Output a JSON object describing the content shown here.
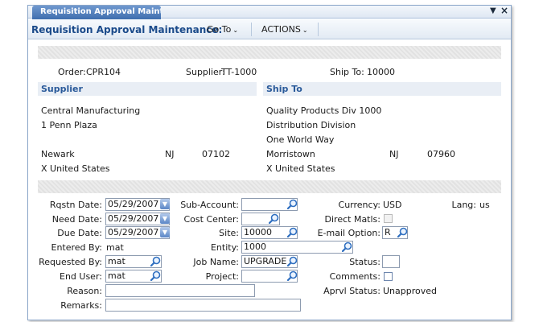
{
  "tab": {
    "label": "Requisition Approval Mainte..."
  },
  "window_controls": {
    "dropdown": "▼",
    "close": "×"
  },
  "menubar": {
    "title": "Requisition Approval Maintenance:",
    "goto_label": "Go To",
    "actions_label": "ACTIONS"
  },
  "header": {
    "order_label": "Order:",
    "order_value": "CPR104",
    "supplier_label": "Supplier:",
    "supplier_value": "TT-1000",
    "shipto_label": "Ship To:",
    "shipto_value": "10000"
  },
  "supplier": {
    "heading": "Supplier",
    "name": "Central Manufacturing",
    "address1": "1 Penn Plaza",
    "city": "Newark",
    "state": "NJ",
    "zip": "07102",
    "country": "X United States"
  },
  "shipto": {
    "heading": "Ship To",
    "name": "Quality Products Div 1000",
    "address1": "Distribution Division",
    "address2": "One World Way",
    "city": "Morristown",
    "state": "NJ",
    "zip": "07960",
    "country": "X United States"
  },
  "form": {
    "rqstn_date_label": "Rqstn Date:",
    "rqstn_date": "05/29/2007",
    "need_date_label": "Need Date:",
    "need_date": "05/29/2007",
    "due_date_label": "Due Date:",
    "due_date": "05/29/2007",
    "entered_by_label": "Entered By:",
    "entered_by": "mat",
    "requested_by_label": "Requested By:",
    "requested_by": "mat",
    "end_user_label": "End User:",
    "end_user": "mat",
    "reason_label": "Reason:",
    "reason": "",
    "remarks_label": "Remarks:",
    "remarks": "",
    "sub_account_label": "Sub-Account:",
    "sub_account": "",
    "cost_center_label": "Cost Center:",
    "cost_center": "",
    "site_label": "Site:",
    "site": "10000",
    "entity_label": "Entity:",
    "entity": "1000",
    "job_name_label": "Job Name:",
    "job_name": "UPGRADE",
    "project_label": "Project:",
    "project": "",
    "currency_label": "Currency:",
    "currency": "USD",
    "lang_label": "Lang:",
    "lang": "us",
    "direct_matls_label": "Direct Matls:",
    "email_option_label": "E-mail Option:",
    "email_option": "R",
    "status_label": "Status:",
    "status": "",
    "comments_label": "Comments:",
    "aprvl_status_label": "Aprvl Status:",
    "aprvl_status": "Unapproved"
  },
  "colors": {
    "accent": "#1a4a8a",
    "section_text": "#2a5a9a",
    "tab_bg": "#4a78b8"
  }
}
